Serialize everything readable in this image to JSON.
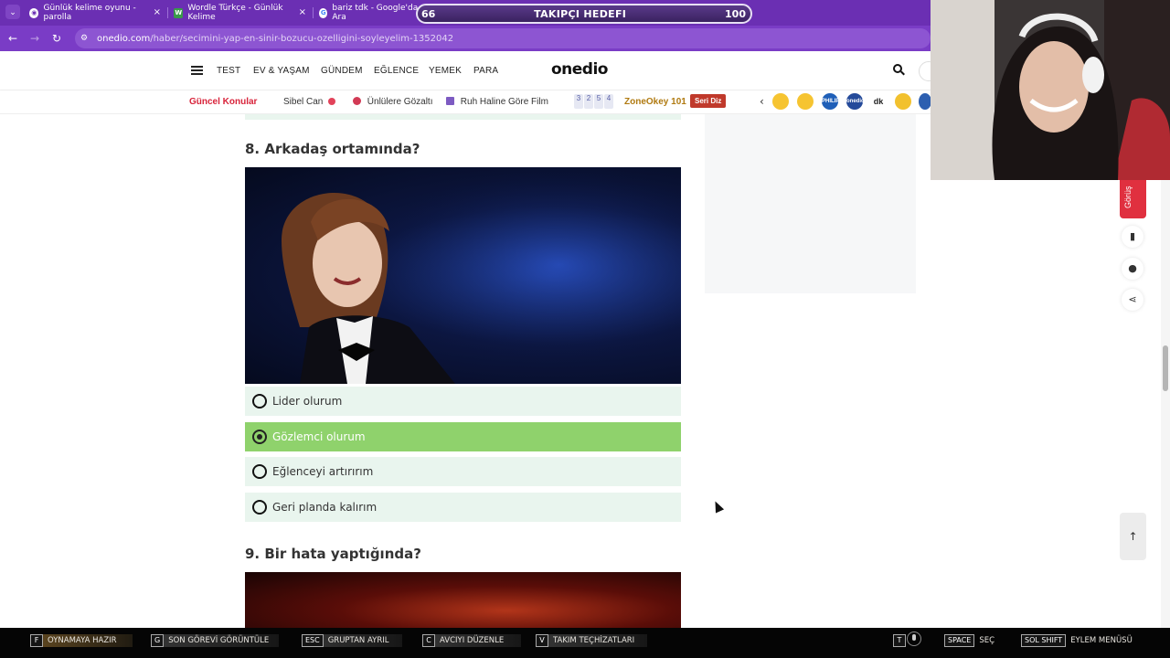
{
  "browser": {
    "tabs": [
      {
        "favicon": "onedio-favicon",
        "label": "Günlük kelime oyunu - parolla"
      },
      {
        "favicon": "W",
        "label": "Wordle Türkçe - Günlük Kelime"
      },
      {
        "favicon": "google-favicon",
        "label": "bariz tdk - Google'da Ara"
      }
    ],
    "tab_close": "×",
    "url_domain": "onedio.com",
    "url_path": "/haber/secimini-yap-en-sinir-bozucu-ozelligini-soyleyelim-1352042"
  },
  "overlay": {
    "follower_goal": {
      "current": "66",
      "title": "TAKIPÇI HEDEFI",
      "target": "100"
    }
  },
  "site": {
    "nav": [
      "TEST",
      "EV & YAŞAM",
      "GÜNDEM",
      "EĞLENCE",
      "YEMEK",
      "PARA"
    ],
    "logo": "onedio",
    "topics_title": "Güncel Konular",
    "topics": [
      "Sibel Can",
      "Ünlülere Gözaltı",
      "Ruh Haline Göre Film"
    ],
    "zone_tiles": [
      "3",
      "2",
      "5",
      "4"
    ],
    "zoneokey": "ZoneOkey 101",
    "seri_diz": "Seri Diz",
    "reactions": [
      "sad-emoji",
      "smile-emoji",
      "philips-logo",
      "onedio-logo",
      "dk-logo",
      "emoji-glasses",
      "flower-logo"
    ],
    "reaction_labels": [
      "",
      "",
      "PHILIPS",
      "onedio",
      "dk",
      "",
      ""
    ]
  },
  "quiz": {
    "question_8": {
      "title": "8. Arkadaş ortamında?",
      "options": [
        {
          "label": "Lider olurum",
          "selected": false
        },
        {
          "label": "Gözlemci olurum",
          "selected": true
        },
        {
          "label": "Eğlenceyi artırırım",
          "selected": false
        },
        {
          "label": "Geri planda kalırım",
          "selected": false
        }
      ]
    },
    "question_9": {
      "title": "9. Bir hata yaptığında?"
    }
  },
  "tools": {
    "gorus": "Görüş",
    "bookmark_icon": "bookmark-icon",
    "comments_icon": "comments-icon",
    "share_icon": "share-icon",
    "scroll_top": "↑"
  },
  "hotkeys": [
    {
      "key": "F",
      "label": "OYNAMAYA HAZIR"
    },
    {
      "key": "G",
      "label": "SON GÖREVİ GÖRÜNTÜLE"
    },
    {
      "key": "ESC",
      "label": "GRUPTAN AYRIL"
    },
    {
      "key": "C",
      "label": "AVCIYI DÜZENLE"
    },
    {
      "key": "V",
      "label": "TAKIM TEÇHİZATLARI"
    },
    {
      "key": "T",
      "label": ""
    },
    {
      "key": "SPACE",
      "label": "SEÇ"
    },
    {
      "key": "SOL SHIFT",
      "label": "EYLEM MENÜSÜ"
    }
  ],
  "colors": {
    "browser_purple": "#6b2fb3",
    "accent_red": "#d8233a",
    "option_bg": "#e9f5ee",
    "option_selected": "#8fd26c",
    "zoneokey": "#b07a10"
  }
}
